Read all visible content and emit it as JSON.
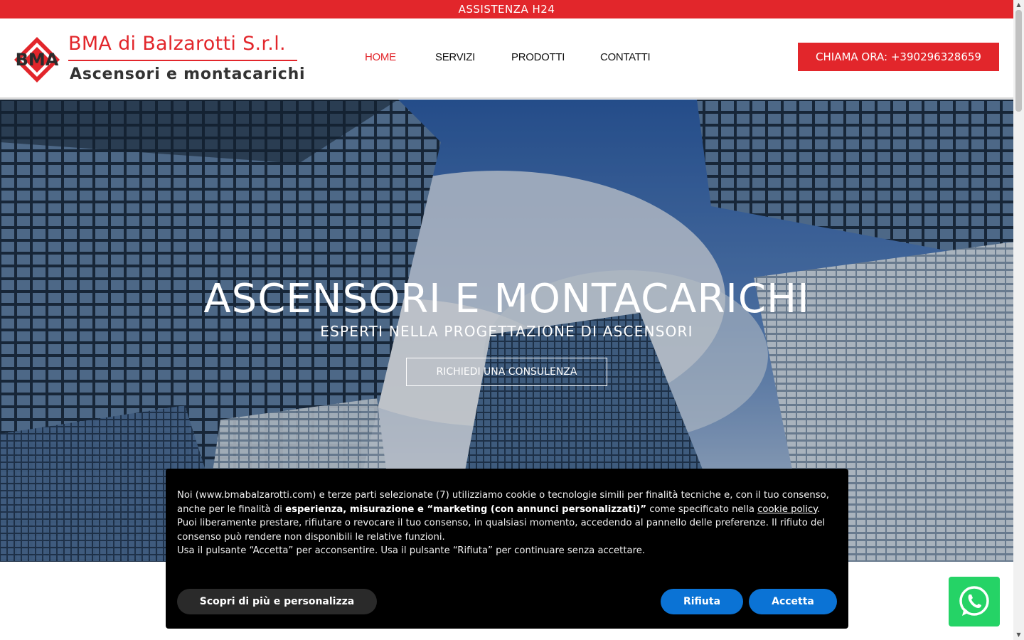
{
  "topbar": {
    "text": "ASSISTENZA H24"
  },
  "logo": {
    "mark_text": "BMA",
    "title": "BMA di Balzarotti S.r.l.",
    "subtitle": "Ascensori e montacarichi"
  },
  "nav": {
    "items": [
      {
        "label": "HOME",
        "active": true
      },
      {
        "label": "SERVIZI",
        "active": false
      },
      {
        "label": "PRODOTTI",
        "active": false
      },
      {
        "label": "CONTATTI",
        "active": false
      }
    ]
  },
  "call_button": {
    "label": "CHIAMA ORA: +390296328659"
  },
  "hero": {
    "title": "ASCENSORI E MONTACARICHI",
    "subtitle": "ESPERTI NELLA PROGETTAZIONE DI ASCENSORI",
    "cta": "RICHIEDI UNA CONSULENZA"
  },
  "cookie": {
    "p1_before": "Noi (www.bmabalzarotti.com) e terze parti selezionate (7) utilizziamo cookie o tecnologie simili per finalità tecniche e, con il tuo consenso, anche per le finalità di ",
    "p1_bold": "esperienza, misurazione e “marketing (con annunci personalizzati)”",
    "p1_after": " come specificato nella ",
    "p1_link": "cookie policy",
    "p1_end": ".",
    "p2": "Puoi liberamente prestare, rifiutare o revocare il tuo consenso, in qualsiasi momento, accedendo al pannello delle preferenze. Il rifiuto del consenso può rendere non disponibili le relative funzioni.",
    "p3": "Usa il pulsante “Accetta” per acconsentire. Usa il pulsante “Rifiuta” per continuare senza accettare.",
    "more_button": "Scopri di più e personalizza",
    "reject_button": "Rifiuta",
    "accept_button": "Accetta"
  },
  "icons": {
    "whatsapp": "whatsapp-icon",
    "logo": "bma-diamond-logo"
  },
  "colors": {
    "brand_red": "#e2262b",
    "cookie_button_blue": "#0b73d5",
    "whatsapp_green": "#25d366"
  }
}
